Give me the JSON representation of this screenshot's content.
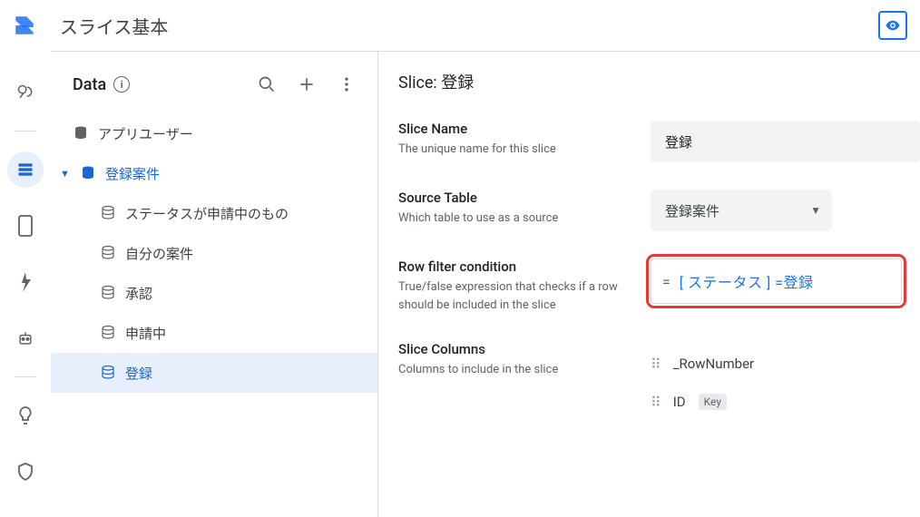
{
  "app_title": "スライス基本",
  "data_panel": {
    "header": "Data",
    "items": [
      {
        "name": "アプリユーザー"
      },
      {
        "name": "登録案件",
        "expanded": true,
        "selected_parent": true,
        "children": [
          {
            "name": "ステータスが申請中のもの"
          },
          {
            "name": "自分の案件"
          },
          {
            "name": "承認"
          },
          {
            "name": "申請中"
          },
          {
            "name": "登録",
            "selected": true
          }
        ]
      }
    ]
  },
  "detail": {
    "title_prefix": "Slice: ",
    "title_value": "登録",
    "slice_name": {
      "label": "Slice Name",
      "desc": "The unique name for this slice",
      "value": "登録"
    },
    "source_table": {
      "label": "Source Table",
      "desc": "Which table to use as a source",
      "value": "登録案件"
    },
    "row_filter": {
      "label": "Row filter condition",
      "desc": "True/false expression that checks if a row should be included in the slice",
      "expr": "[ ステータス ] =登録"
    },
    "slice_columns": {
      "label": "Slice Columns",
      "desc": "Columns to include in the slice",
      "columns": [
        {
          "name": "_RowNumber"
        },
        {
          "name": "ID",
          "key": "Key"
        }
      ]
    }
  }
}
